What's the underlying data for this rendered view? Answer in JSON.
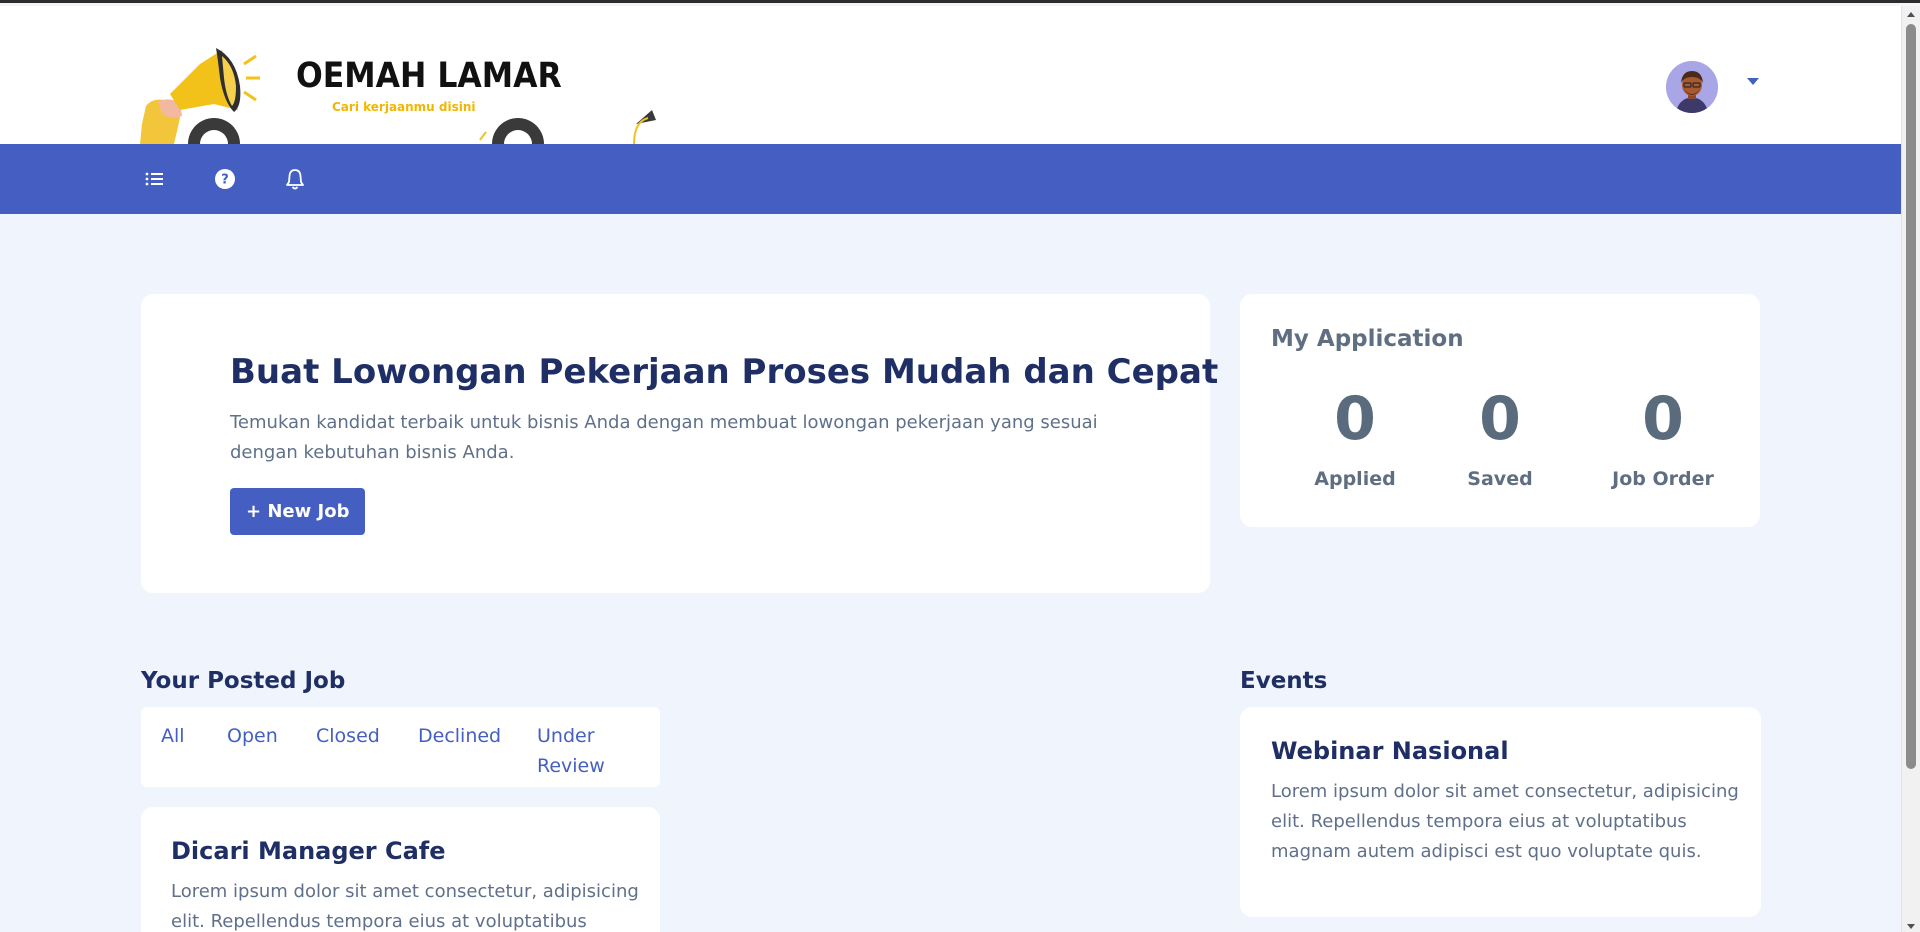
{
  "header": {
    "brand_title": "OEMAH LAMAR",
    "brand_tagline": "Cari kerjaanmu disini"
  },
  "navbar": {
    "icons": [
      "list-icon",
      "help-icon",
      "bell-icon"
    ]
  },
  "hero": {
    "title": "Buat Lowongan Pekerjaan Proses Mudah dan Cepat",
    "description": "Temukan kandidat terbaik untuk bisnis Anda dengan membuat lowongan pekerjaan yang sesuai dengan kebutuhan bisnis Anda.",
    "button_label": "+ New Job"
  },
  "my_application": {
    "title": "My Application",
    "stats": [
      {
        "value": "0",
        "label": "Applied"
      },
      {
        "value": "0",
        "label": "Saved"
      },
      {
        "value": "0",
        "label": "Job Order"
      }
    ]
  },
  "posted_jobs": {
    "title": "Your Posted Job",
    "tabs": [
      "All",
      "Open",
      "Closed",
      "Declined",
      "Under Review"
    ],
    "items": [
      {
        "title": "Dicari Manager Cafe",
        "description": "Lorem ipsum dolor sit amet consectetur, adipisicing elit. Repellendus tempora eius at voluptatibus"
      }
    ]
  },
  "events": {
    "title": "Events",
    "items": [
      {
        "title": "Webinar Nasional",
        "description": "Lorem ipsum dolor sit amet consectetur, adipisicing elit. Repellendus tempora eius at voluptatibus magnam autem adipisci est quo voluptate quis."
      }
    ]
  },
  "colors": {
    "primary": "#445fc1",
    "navy_text": "#1f2f66",
    "page_bg": "#eff4fd",
    "accent_yellow": "#f2b600"
  }
}
